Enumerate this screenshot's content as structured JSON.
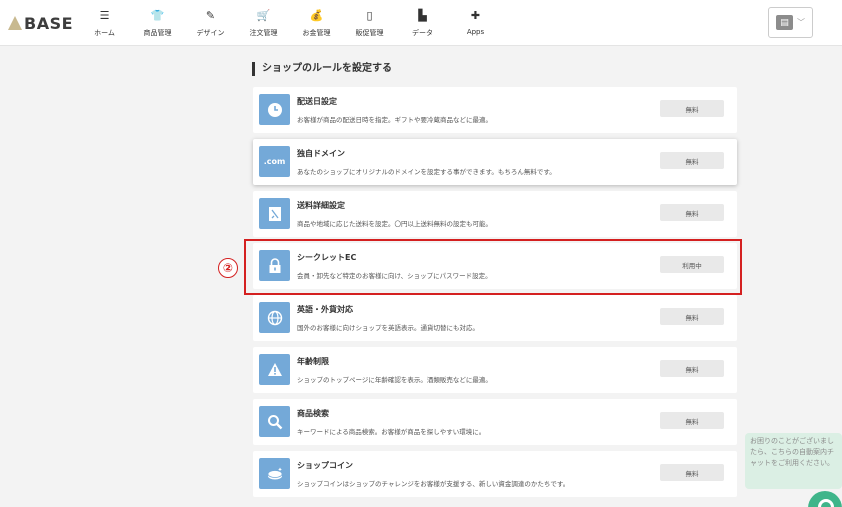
{
  "header": {
    "logo_text": "BASE",
    "nav": [
      {
        "label": "ホーム",
        "icon": "list-icon",
        "glyph": "☰"
      },
      {
        "label": "商品管理",
        "icon": "tshirt-icon",
        "glyph": "👕"
      },
      {
        "label": "デザイン",
        "icon": "brush-icon",
        "glyph": "✎"
      },
      {
        "label": "注文管理",
        "icon": "cart-icon",
        "glyph": "🛒"
      },
      {
        "label": "お金管理",
        "icon": "money-bag-icon",
        "glyph": "💰"
      },
      {
        "label": "販促管理",
        "icon": "smartphone-icon",
        "glyph": "▯"
      },
      {
        "label": "データ",
        "icon": "bar-chart-icon",
        "glyph": "▙"
      },
      {
        "label": "Apps",
        "icon": "puzzle-icon",
        "glyph": "✚"
      }
    ]
  },
  "page": {
    "section_title": "ショップのルールを設定する"
  },
  "annotation": {
    "step_number": "②",
    "color": "#d42020"
  },
  "features": [
    {
      "name": "配送日設定",
      "desc": "お客様が商品の配送日時を指定。ギフトや要冷蔵商品などに最適。",
      "button": "無料",
      "icon": "clock-icon",
      "glyph": "◷"
    },
    {
      "name": "独自ドメイン",
      "desc": "あなたのショップにオリジナルのドメインを設定する事ができます。もちろん無料です。",
      "button": "無料",
      "icon": "dot-com-icon",
      "glyph": ".com"
    },
    {
      "name": "送料詳細設定",
      "desc": "商品や地域に応じた送料を設定。〇円以上送料無料の設定も可能。",
      "button": "無料",
      "icon": "shipping-doc-icon",
      "glyph": "▤"
    },
    {
      "name": "シークレットEC",
      "desc": "会員・卸先など特定のお客様に向け、ショップにパスワード設定。",
      "button": "利用中",
      "icon": "lock-icon",
      "glyph": "🔒"
    },
    {
      "name": "英語・外貨対応",
      "desc": "国外のお客様に向けショップを英語表示。通貨切替にも対応。",
      "button": "無料",
      "icon": "globe-icon",
      "glyph": "⊕"
    },
    {
      "name": "年齢制限",
      "desc": "ショップのトップページに年齢確認を表示。酒類販売などに最適。",
      "button": "無料",
      "icon": "warning-icon",
      "glyph": "▲"
    },
    {
      "name": "商品検索",
      "desc": "キーワードによる商品検索。お客様が商品を探しやすい環境に。",
      "button": "無料",
      "icon": "search-icon",
      "glyph": "⚲"
    },
    {
      "name": "ショップコイン",
      "desc": "ショップコインはショップのチャレンジをお客様が支援する、新しい資金調達のかたちです。",
      "button": "無料",
      "icon": "coin-icon",
      "glyph": "◎"
    }
  ],
  "chat": {
    "message": "お困りのことがございましたら、こちらの自動案内チャットをご利用ください。"
  },
  "colors": {
    "accent_blue": "#74a9d8",
    "chat_green": "#3fb58a"
  }
}
